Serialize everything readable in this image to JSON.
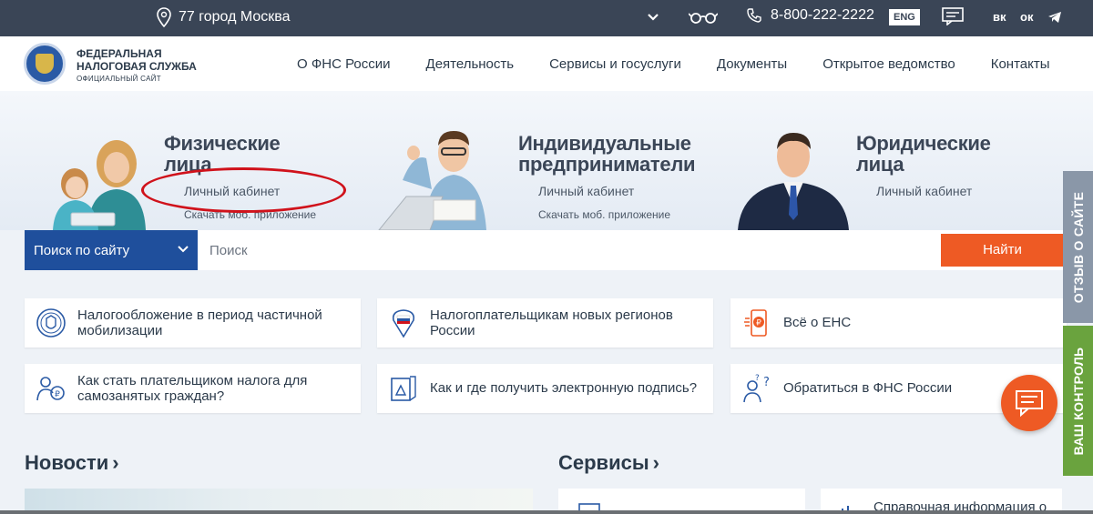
{
  "topbar": {
    "region": "77 город Москва",
    "phone": "8-800-222-2222",
    "lang": "ENG",
    "social": [
      "вк",
      "ок"
    ]
  },
  "header": {
    "org_line1": "ФЕДЕРАЛЬНАЯ",
    "org_line2": "НАЛОГОВАЯ СЛУЖБА",
    "org_line3": "ОФИЦИАЛЬНЫЙ САЙТ",
    "nav": [
      "О ФНС России",
      "Деятельность",
      "Сервисы и госуслуги",
      "Документы",
      "Открытое ведомство",
      "Контакты"
    ]
  },
  "categories": [
    {
      "title1": "Физические",
      "title2": "лица",
      "link": "Личный кабинет",
      "sub": "Скачать моб. приложение"
    },
    {
      "title1": "Индивидуальные",
      "title2": "предприниматели",
      "link": "Личный кабинет",
      "sub": "Скачать моб. приложение"
    },
    {
      "title1": "Юридические",
      "title2": "лица",
      "link": "Личный кабинет"
    }
  ],
  "search": {
    "scope": "Поиск по сайту",
    "placeholder": "Поиск",
    "button": "Найти"
  },
  "quick_links": [
    "Налогообложение в период частичной мобилизации",
    "Налогоплательщикам новых регионов России",
    "Всё о ЕНС",
    "Как стать плательщиком налога для самозанятых граждан?",
    "Как и где получить электронную подпись?",
    "Обратиться в ФНС России"
  ],
  "side_tabs": {
    "feedback": "ОТЗЫВ О САЙТЕ",
    "control": "ВАШ КОНТРОЛЬ"
  },
  "sections": {
    "news": "Новости",
    "services": "Сервисы",
    "service_card_text": "Справочная информация о"
  },
  "colors": {
    "topbar": "#3a4556",
    "brand_blue": "#1f4f9c",
    "accent_orange": "#ee5a24",
    "feedback_tab": "#8a97a8",
    "control_tab": "#6aa33e",
    "annotation_red": "#d0121b"
  }
}
